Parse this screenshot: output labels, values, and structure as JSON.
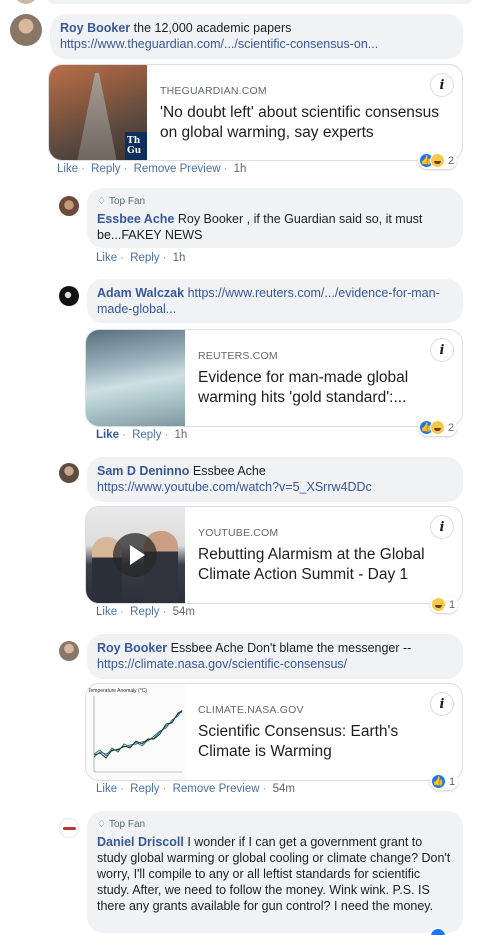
{
  "comments": [
    {
      "name": "Roy Booker",
      "text": "the 12,000 academic papers",
      "link": "https://www.theguardian.com/.../scientific-consensus-on...",
      "card": {
        "domain": "THEGUARDIAN.COM",
        "title": "'No doubt left' about scientific consensus on global warming, say experts"
      },
      "actions": {
        "like": "Like",
        "reply": "Reply",
        "remove": "Remove Preview",
        "time": "1h"
      },
      "reactions": {
        "count": "2"
      }
    },
    {
      "badge": "Top Fan",
      "name": "Essbee Ache",
      "text": "Roy Booker , if the Guardian said so, it must be...FAKEY NEWS",
      "actions": {
        "like": "Like",
        "reply": "Reply",
        "time": "1h"
      }
    },
    {
      "name": "Adam Walczak",
      "link": "https://www.reuters.com/.../evidence-for-man-made-global...",
      "card": {
        "domain": "REUTERS.COM",
        "title": "Evidence for man-made global warming hits 'gold standard':..."
      },
      "actions": {
        "like": "Like",
        "reply": "Reply",
        "time": "1h"
      },
      "reactions": {
        "count": "2"
      }
    },
    {
      "name": "Sam D Deninno",
      "text": "Essbee Ache",
      "link": "https://www.youtube.com/watch?v=5_XSrrw4DDc",
      "card": {
        "domain": "YOUTUBE.COM",
        "title": "Rebutting Alarmism at the Global Climate Action Summit - Day 1"
      },
      "actions": {
        "like": "Like",
        "reply": "Reply",
        "time": "54m"
      },
      "reactions": {
        "count": "1"
      }
    },
    {
      "name": "Roy Booker",
      "text": "Essbee Ache Don't blame the messenger --",
      "link": "https://climate.nasa.gov/scientific-consensus/",
      "card": {
        "domain": "CLIMATE.NASA.GOV",
        "title": "Scientific Consensus: Earth's Climate is Warming",
        "chart_caption": "Temperature Anomaly (°C)"
      },
      "actions": {
        "like": "Like",
        "reply": "Reply",
        "remove": "Remove Preview",
        "time": "54m"
      },
      "reactions": {
        "count": "1"
      }
    },
    {
      "badge": "Top Fan",
      "name": "Daniel Driscoll",
      "text": "I wonder if I can get a government grant to study global warming or global cooling or climate change? Don't worry, I'll compile to any or all leftist standards for scientific study. After, we need to follow the money. Wink wink. P.S. IS there any grants available for gun control? I need the money."
    }
  ],
  "colors": {
    "name": "#385898",
    "bubble": "#f0f2f5",
    "like_blue": "#1877f2"
  }
}
